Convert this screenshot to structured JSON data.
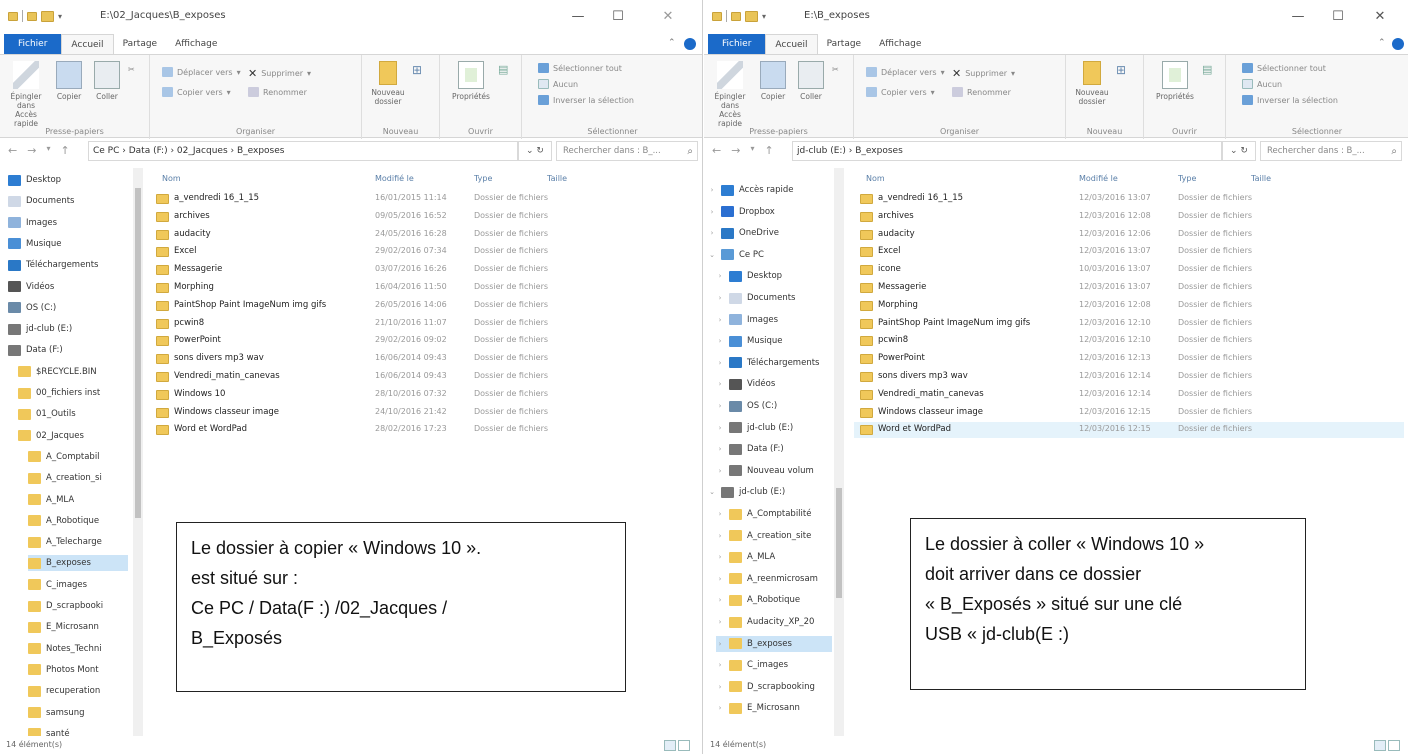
{
  "left": {
    "title": "E:\\02_Jacques\\B_exposes",
    "tabs": [
      "Fichier",
      "Accueil",
      "Partage",
      "Affichage"
    ],
    "ribbon": {
      "groups": [
        "Presse-papiers",
        "Organiser",
        "Nouveau",
        "Ouvrir",
        "Sélectionner"
      ],
      "pin": "Épingler dans Accès rapide",
      "copy": "Copier",
      "paste": "Coller",
      "move_to": "Déplacer vers",
      "copy_to": "Copier vers",
      "delete": "Supprimer",
      "rename": "Renommer",
      "new_folder": "Nouveau dossier",
      "properties": "Propriétés",
      "select_all": "Sélectionner tout",
      "select_none": "Aucun",
      "invert_selection": "Inverser la sélection"
    },
    "address": "Ce PC  ›  Data (F:)  ›  02_Jacques  ›  B_exposes",
    "search_placeholder": "Rechercher dans : B_...",
    "nav": [
      "Desktop",
      "Documents",
      "Images",
      "Musique",
      "Téléchargements",
      "Vidéos",
      "OS (C:)",
      "jd-club (E:)",
      "Data (F:)",
      "$RECYCLE.BIN",
      "00_fichiers inst",
      "01_Outils",
      "02_Jacques",
      "A_Comptabil",
      "A_creation_si",
      "A_MLA",
      "A_Robotique",
      "A_Telecharge",
      "B_exposes",
      "C_images",
      "D_scrapbooki",
      "E_Microsann",
      "Notes_Techni",
      "Photos Mont",
      "recuperation",
      "samsung",
      "santé"
    ],
    "columns": [
      "Nom",
      "Modifié le",
      "Type",
      "Taille"
    ],
    "files": [
      {
        "name": "a_vendredi 16_1_15",
        "date": "16/01/2015 11:14",
        "type": "Dossier de fichiers"
      },
      {
        "name": "archives",
        "date": "09/05/2016 16:52",
        "type": "Dossier de fichiers"
      },
      {
        "name": "audacity",
        "date": "24/05/2016 16:28",
        "type": "Dossier de fichiers"
      },
      {
        "name": "Excel",
        "date": "29/02/2016 07:34",
        "type": "Dossier de fichiers"
      },
      {
        "name": "Messagerie",
        "date": "03/07/2016 16:26",
        "type": "Dossier de fichiers"
      },
      {
        "name": "Morphing",
        "date": "16/04/2016 11:50",
        "type": "Dossier de fichiers"
      },
      {
        "name": "PaintShop Paint  ImageNum img gifs",
        "date": "26/05/2016 14:06",
        "type": "Dossier de fichiers"
      },
      {
        "name": "pcwin8",
        "date": "21/10/2016 11:07",
        "type": "Dossier de fichiers"
      },
      {
        "name": "PowerPoint",
        "date": "29/02/2016 09:02",
        "type": "Dossier de fichiers"
      },
      {
        "name": "sons divers mp3 wav",
        "date": "16/06/2014 09:43",
        "type": "Dossier de fichiers"
      },
      {
        "name": "Vendredi_matin_canevas",
        "date": "16/06/2014 09:43",
        "type": "Dossier de fichiers"
      },
      {
        "name": "Windows 10",
        "date": "28/10/2016 07:32",
        "type": "Dossier de fichiers"
      },
      {
        "name": "Windows classeur image",
        "date": "24/10/2016 21:42",
        "type": "Dossier de fichiers"
      },
      {
        "name": "Word et WordPad",
        "date": "28/02/2016 17:23",
        "type": "Dossier de fichiers"
      }
    ],
    "status": "14 élément(s)",
    "note": [
      "Le dossier à copier « Windows 10 ».",
      "est situé sur :",
      "Ce PC / Data(F :) /02_Jacques /",
      "B_Exposés"
    ]
  },
  "right": {
    "title": "E:\\B_exposes",
    "tabs": [
      "Fichier",
      "Accueil",
      "Partage",
      "Affichage"
    ],
    "ribbon": {
      "groups": [
        "Presse-papiers",
        "Organiser",
        "Nouveau",
        "Ouvrir",
        "Sélectionner"
      ],
      "pin": "Épingler dans Accès rapide",
      "copy": "Copier",
      "paste": "Coller",
      "move_to": "Déplacer vers",
      "copy_to": "Copier vers",
      "delete": "Supprimer",
      "rename": "Renommer",
      "new_folder": "Nouveau dossier",
      "properties": "Propriétés",
      "select_all": "Sélectionner tout",
      "select_none": "Aucun",
      "invert_selection": "Inverser la sélection"
    },
    "address": "jd-club (E:)  ›  B_exposes",
    "search_placeholder": "Rechercher dans : B_...",
    "nav": [
      "Accès rapide",
      "Dropbox",
      "OneDrive",
      "Ce PC",
      "Desktop",
      "Documents",
      "Images",
      "Musique",
      "Téléchargements",
      "Vidéos",
      "OS (C:)",
      "jd-club (E:)",
      "Data (F:)",
      "Nouveau volum",
      "jd-club (E:)",
      "A_Comptabilité",
      "A_creation_site",
      "A_MLA",
      "A_reenmicrosam",
      "A_Robotique",
      "Audacity_XP_20",
      "B_exposes",
      "C_images",
      "D_scrapbooking",
      "E_Microsann"
    ],
    "columns": [
      "Nom",
      "Modifié le",
      "Type",
      "Taille"
    ],
    "files": [
      {
        "name": "a_vendredi 16_1_15",
        "date": "12/03/2016 13:07",
        "type": "Dossier de fichiers"
      },
      {
        "name": "archives",
        "date": "12/03/2016 12:08",
        "type": "Dossier de fichiers"
      },
      {
        "name": "audacity",
        "date": "12/03/2016 12:06",
        "type": "Dossier de fichiers"
      },
      {
        "name": "Excel",
        "date": "12/03/2016 13:07",
        "type": "Dossier de fichiers"
      },
      {
        "name": "icone",
        "date": "10/03/2016 13:07",
        "type": "Dossier de fichiers"
      },
      {
        "name": "Messagerie",
        "date": "12/03/2016 13:07",
        "type": "Dossier de fichiers"
      },
      {
        "name": "Morphing",
        "date": "12/03/2016 12:08",
        "type": "Dossier de fichiers"
      },
      {
        "name": "PaintShop Paint  ImageNum img gifs",
        "date": "12/03/2016 12:10",
        "type": "Dossier de fichiers"
      },
      {
        "name": "pcwin8",
        "date": "12/03/2016 12:10",
        "type": "Dossier de fichiers"
      },
      {
        "name": "PowerPoint",
        "date": "12/03/2016 12:13",
        "type": "Dossier de fichiers"
      },
      {
        "name": "sons divers mp3 wav",
        "date": "12/03/2016 12:14",
        "type": "Dossier de fichiers"
      },
      {
        "name": "Vendredi_matin_canevas",
        "date": "12/03/2016 12:14",
        "type": "Dossier de fichiers"
      },
      {
        "name": "Windows classeur image",
        "date": "12/03/2016 12:15",
        "type": "Dossier de fichiers"
      },
      {
        "name": "Word et WordPad",
        "date": "12/03/2016 12:15",
        "type": "Dossier de fichiers"
      }
    ],
    "status": "14 élément(s)",
    "note": [
      "Le dossier à coller « Windows 10 »",
      "doit arriver dans ce dossier",
      "« B_Exposés » situé sur une clé",
      "USB « jd-club(E :)"
    ]
  },
  "colors": {
    "file_tab": "#1b6ac9",
    "folder": "#f0c85a",
    "selection": "#cce4f7",
    "column_header": "#5a7fa8"
  }
}
